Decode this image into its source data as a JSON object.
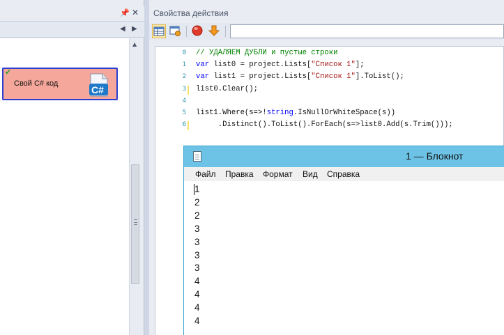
{
  "left_panel": {
    "node": {
      "label": "Свой C# код",
      "icon": "csharp-file-icon",
      "status_icon": "check-icon"
    }
  },
  "right_panel": {
    "title": "Свойства действия",
    "search": {
      "value": "",
      "placeholder": ""
    }
  },
  "editor": {
    "line_numbers": [
      "0",
      "1",
      "2",
      "3",
      "4",
      "5",
      "6"
    ],
    "lines": [
      [
        [
          "cm",
          "// УДАЛЯЕМ ДУБЛИ и пустые строки"
        ]
      ],
      [
        [
          "kw",
          "var"
        ],
        [
          "",
          " list0 = project.Lists["
        ],
        [
          "str",
          "\"Список 1\""
        ],
        [
          "",
          "];"
        ]
      ],
      [
        [
          "kw",
          "var"
        ],
        [
          "",
          " list1 = project.Lists["
        ],
        [
          "str",
          "\"Список 1\""
        ],
        [
          "",
          "].ToList();"
        ]
      ],
      [
        [
          "",
          "list0.Clear();"
        ]
      ],
      [],
      [
        [
          "",
          "list1.Where(s=>!"
        ],
        [
          "kw",
          "string"
        ],
        [
          "",
          ".IsNullOrWhiteSpace(s))"
        ]
      ],
      [
        [
          "",
          "     .Distinct().ToList().ForEach(s=>list0.Add(s.Trim()));"
        ]
      ]
    ]
  },
  "notepad": {
    "title": "1 — Блокнот",
    "menu": [
      "Файл",
      "Правка",
      "Формат",
      "Вид",
      "Справка"
    ],
    "content_lines": [
      "1",
      "2",
      "2",
      "3",
      "3",
      "3",
      "3",
      "4",
      "4",
      "4",
      "4"
    ]
  },
  "colors": {
    "node_fill": "#f4a79a",
    "node_border": "#2c3fd0",
    "notepad_titlebar": "#6dc3e6"
  }
}
